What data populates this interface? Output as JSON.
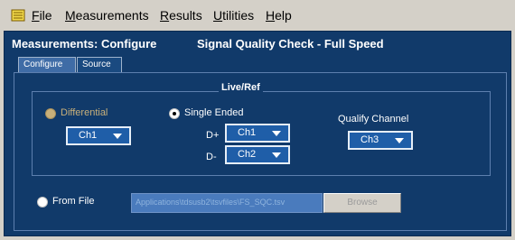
{
  "menubar": {
    "items": [
      {
        "mnemonic": "F",
        "rest": "ile"
      },
      {
        "mnemonic": "M",
        "rest": "easurements"
      },
      {
        "mnemonic": "R",
        "rest": "esults"
      },
      {
        "mnemonic": "U",
        "rest": "tilities"
      },
      {
        "mnemonic": "H",
        "rest": "elp"
      }
    ]
  },
  "panel": {
    "title": "Measurements: Configure",
    "subtitle": "Signal Quality Check  - Full Speed"
  },
  "tabs": [
    {
      "label": "Configure"
    },
    {
      "label": "Source"
    }
  ],
  "liveref": {
    "title": "Live/Ref",
    "differential_label": "Differential",
    "differential_channel": "Ch1",
    "single_ended_label": "Single Ended",
    "dplus_label": "D+",
    "dplus_channel": "Ch1",
    "dminus_label": "D-",
    "dminus_channel": "Ch2",
    "qualify_label": "Qualify Channel",
    "qualify_channel": "Ch3"
  },
  "from_file": {
    "label": "From File",
    "path": "Applications\\tdsusb2\\tsvfiles\\FS_SQC.tsv",
    "browse_label": "Browse"
  },
  "colors": {
    "panel_bg": "#113a6a",
    "accent": "#1f5ea8",
    "disabled_text": "#c9b07a"
  }
}
